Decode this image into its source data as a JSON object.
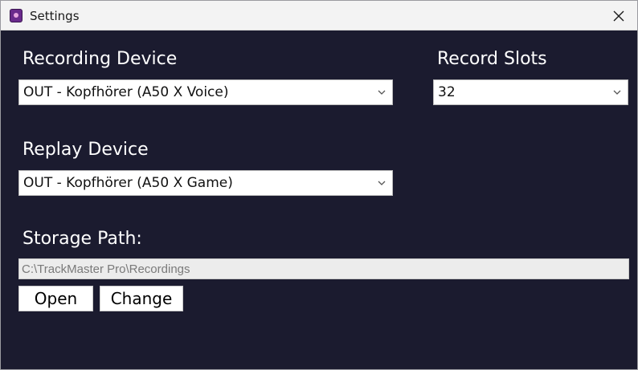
{
  "window": {
    "title": "Settings",
    "app_icon": "app-icon",
    "close_icon": "close-icon"
  },
  "recording_device": {
    "label": "Recording Device",
    "value": "OUT - Kopfhörer (A50 X Voice)"
  },
  "record_slots": {
    "label": "Record Slots",
    "value": "32"
  },
  "replay_device": {
    "label": "Replay Device",
    "value": "OUT - Kopfhörer (A50 X Game)"
  },
  "storage": {
    "label": "Storage Path:",
    "path": "C:\\TrackMaster Pro\\Recordings",
    "open_label": "Open",
    "change_label": "Change"
  },
  "colors": {
    "background": "#1b1b2f",
    "titlebar": "#f3f3f3"
  }
}
